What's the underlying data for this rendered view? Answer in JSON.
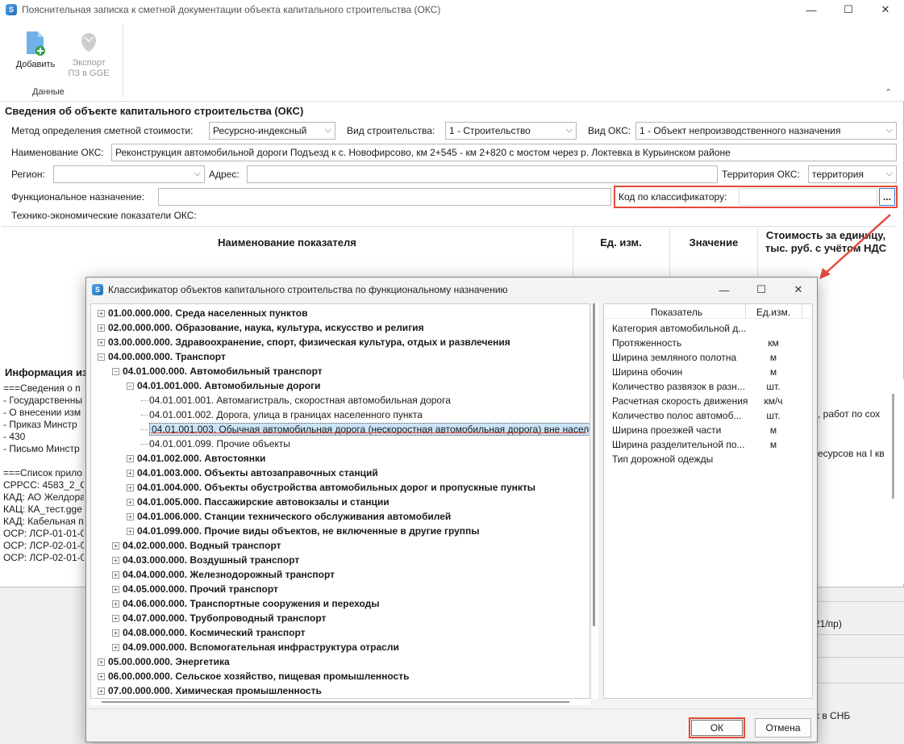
{
  "window": {
    "title": "Пояснительная записка к сметной документации объекта капитального строительства (ОКС)",
    "minimize": "—",
    "maximize": "☐",
    "close": "✕"
  },
  "ribbon": {
    "add_label": "Добавить",
    "export_label1": "Экспорт",
    "export_label2": "ПЗ в GGE",
    "group_label": "Данные",
    "collapse": "⌃"
  },
  "form": {
    "section_title": "Сведения об объекте капитального строительства (ОКС)",
    "method_label": "Метод определения сметной стоимости:",
    "method_value": "Ресурсно-индексный",
    "build_type_label": "Вид строительства:",
    "build_type_value": "1 - Строительство",
    "oks_type_label": "Вид ОКС:",
    "oks_type_value": "1 - Объект непроизводственного назначения",
    "name_label": "Наименование ОКС:",
    "name_value": "Реконструкция автомобильной дороги Подъезд к с. Новофирсово, км 2+545 - км 2+820 с мостом через р. Локтевка в Курьинском районе",
    "region_label": "Регион:",
    "region_value": "",
    "address_label": "Адрес:",
    "address_value": "",
    "territory_label": "Территория ОКС:",
    "territory_value": "территория",
    "func_label": "Функциональное назначение:",
    "func_value": "",
    "code_label": "Код по классификатору:",
    "code_value": "",
    "code_btn": "...",
    "tep_label": "Технико-экономические показатели ОКС:"
  },
  "grid": {
    "col_name": "Наименование показателя",
    "col_unit": "Ед. изм.",
    "col_value": "Значение",
    "col_cost1": "Стоимость за единицу,",
    "col_cost2": "тыс. руб. с учётом НДС"
  },
  "info": {
    "header": "Информация из",
    "lines": [
      "===Сведения о п",
      "- Государственны",
      "- О внесении изм",
      "- Приказ Минстр",
      "- 430",
      "- Письмо Минстр",
      "",
      "===Список прило",
      "СРРСС: 4583_2_С",
      "КАД: АО Желдора",
      "КАЦ: КА_тест.gge",
      "КАД: Кабельная п",
      "ОСР: ЛСР-01-01-0",
      "ОСР: ЛСР-02-01-0",
      "ОСР: ЛСР-02-01-0"
    ],
    "right1": ", работ по сох",
    "right2": "есурсов на I кв"
  },
  "below": {
    "t1": "21/пр)",
    "t2": "х в СНБ"
  },
  "dialog": {
    "title": "Классификатор объектов капитального строительства по функциональному назначению",
    "minimize": "—",
    "maximize": "☐",
    "close": "✕",
    "tree": [
      {
        "level": 0,
        "pm": "+",
        "text": "01.00.000.000. Среда населенных пунктов",
        "bold": true
      },
      {
        "level": 0,
        "pm": "+",
        "text": "02.00.000.000. Образование, наука, культура, искусство и религия",
        "bold": true
      },
      {
        "level": 0,
        "pm": "+",
        "text": "03.00.000.000. Здравоохранение, спорт, физическая культура, отдых и развлечения",
        "bold": true
      },
      {
        "level": 0,
        "pm": "−",
        "text": "04.00.000.000. Транспорт",
        "bold": true
      },
      {
        "level": 1,
        "pm": "−",
        "text": "04.01.000.000. Автомобильный транспорт",
        "bold": true
      },
      {
        "level": 2,
        "pm": "−",
        "text": "04.01.001.000. Автомобильные дороги",
        "bold": true
      },
      {
        "level": 3,
        "pm": "",
        "text": "04.01.001.001. Автомагистраль, скоростная автомобильная дорога",
        "bold": false
      },
      {
        "level": 3,
        "pm": "",
        "text": "04.01.001.002. Дорога, улица в границах населенного пункта",
        "bold": false
      },
      {
        "level": 3,
        "pm": "",
        "text": "04.01.001.003. Обычная автомобильная дорога (нескоростная автомобильная дорога) вне населе",
        "bold": false,
        "selected": true
      },
      {
        "level": 3,
        "pm": "",
        "text": "04.01.001.099. Прочие объекты",
        "bold": false
      },
      {
        "level": 2,
        "pm": "+",
        "text": "04.01.002.000. Автостоянки",
        "bold": true
      },
      {
        "level": 2,
        "pm": "+",
        "text": "04.01.003.000. Объекты автозаправочных станций",
        "bold": true
      },
      {
        "level": 2,
        "pm": "+",
        "text": "04.01.004.000. Объекты обустройства автомобильных дорог и пропускные пункты",
        "bold": true
      },
      {
        "level": 2,
        "pm": "+",
        "text": "04.01.005.000. Пассажирские автовокзалы и станции",
        "bold": true
      },
      {
        "level": 2,
        "pm": "+",
        "text": "04.01.006.000. Станции технического обслуживания автомобилей",
        "bold": true
      },
      {
        "level": 2,
        "pm": "+",
        "text": "04.01.099.000. Прочие виды объектов, не включенные в другие группы",
        "bold": true
      },
      {
        "level": 1,
        "pm": "+",
        "text": "04.02.000.000. Водный транспорт",
        "bold": true
      },
      {
        "level": 1,
        "pm": "+",
        "text": "04.03.000.000. Воздушный транспорт",
        "bold": true
      },
      {
        "level": 1,
        "pm": "+",
        "text": "04.04.000.000. Железнодорожный транспорт",
        "bold": true
      },
      {
        "level": 1,
        "pm": "+",
        "text": "04.05.000.000. Прочий транспорт",
        "bold": true
      },
      {
        "level": 1,
        "pm": "+",
        "text": "04.06.000.000. Транспортные сооружения и переходы",
        "bold": true
      },
      {
        "level": 1,
        "pm": "+",
        "text": "04.07.000.000. Трубопроводный транспорт",
        "bold": true
      },
      {
        "level": 1,
        "pm": "+",
        "text": "04.08.000.000. Космический транспорт",
        "bold": true
      },
      {
        "level": 1,
        "pm": "+",
        "text": "04.09.000.000. Вспомогательная инфраструктура отрасли",
        "bold": true
      },
      {
        "level": 0,
        "pm": "+",
        "text": "05.00.000.000. Энергетика",
        "bold": true
      },
      {
        "level": 0,
        "pm": "+",
        "text": "06.00.000.000. Сельское хозяйство, пищевая промышленность",
        "bold": true
      },
      {
        "level": 0,
        "pm": "+",
        "text": "07.00.000.000. Химическая промышленность",
        "bold": true
      }
    ],
    "props_header": {
      "name": "Показатель",
      "unit": "Ед.изм."
    },
    "props": [
      {
        "name": "Категория автомобильной д...",
        "unit": ""
      },
      {
        "name": "Протяженность",
        "unit": "км"
      },
      {
        "name": "Ширина земляного полотна",
        "unit": "м"
      },
      {
        "name": "Ширина обочин",
        "unit": "м"
      },
      {
        "name": "Количество развязок в разн...",
        "unit": "шт."
      },
      {
        "name": "Расчетная скорость движения",
        "unit": "км/ч"
      },
      {
        "name": "Количество полос автомоб...",
        "unit": "шт."
      },
      {
        "name": "Ширина проезжей части",
        "unit": "м"
      },
      {
        "name": "Ширина разделительной по...",
        "unit": "м"
      },
      {
        "name": "Тип дорожной одежды",
        "unit": ""
      }
    ],
    "ok": "ОК",
    "cancel": "Отмена"
  },
  "colors": {
    "highlight": "#e34a3a",
    "selection": "#cce4f7",
    "accent": "#1f6fb5"
  }
}
